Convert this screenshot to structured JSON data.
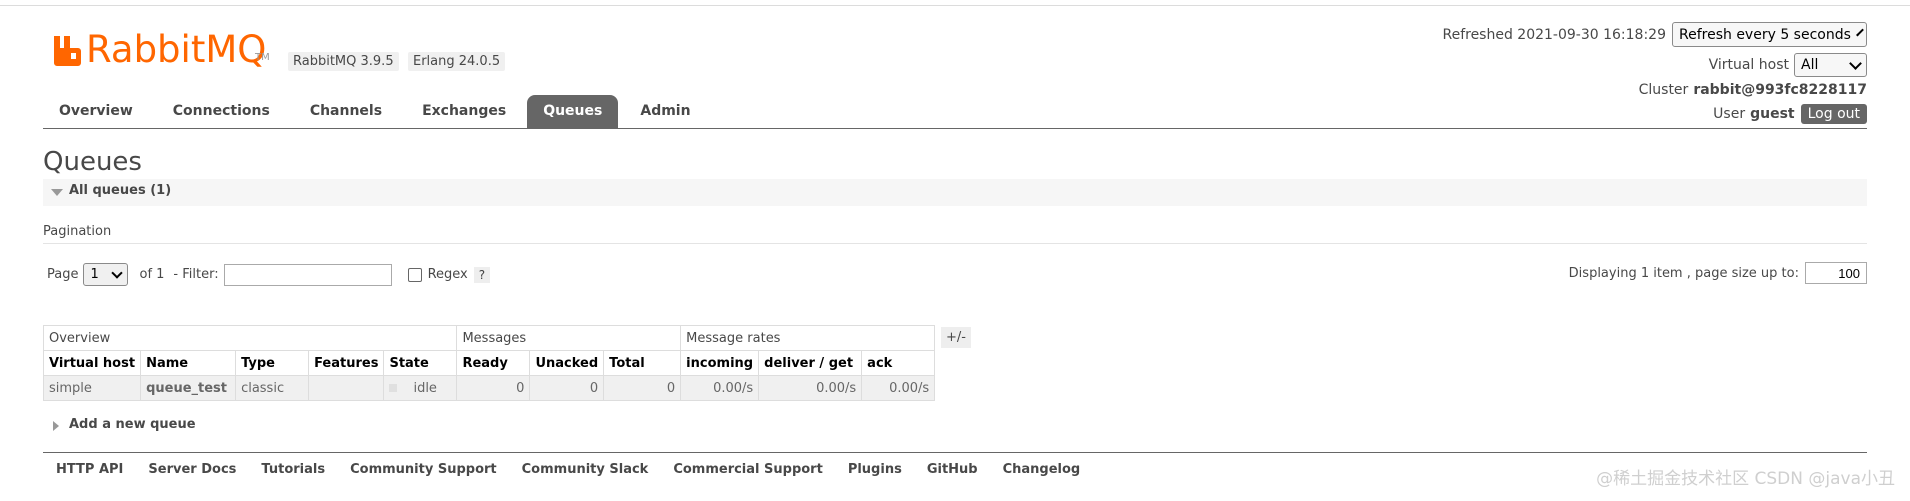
{
  "header": {
    "logo_text": "RabbitMQ",
    "logo_tm": "TM",
    "rabbitmq_version": "RabbitMQ 3.9.5",
    "erlang_version": "Erlang 24.0.5",
    "brand_color": "#ff6600"
  },
  "top_right": {
    "refreshed_label": "Refreshed 2021-09-30 16:18:29",
    "refresh_select": "Refresh every 5 seconds",
    "vhost_label": "Virtual host",
    "vhost_select": "All",
    "cluster_label": "Cluster",
    "cluster_value": "rabbit@993fc8228117",
    "user_label": "User",
    "user_value": "guest",
    "logout_label": "Log out"
  },
  "nav": {
    "tabs": [
      {
        "label": "Overview"
      },
      {
        "label": "Connections"
      },
      {
        "label": "Channels"
      },
      {
        "label": "Exchanges"
      },
      {
        "label": "Queues",
        "active": true
      },
      {
        "label": "Admin"
      }
    ]
  },
  "main": {
    "title": "Queues",
    "section_label": "All queues (1)",
    "pagination_label": "Pagination",
    "page_label": "Page",
    "page_value": "1",
    "of_label": "of 1",
    "filter_label": "- Filter:",
    "filter_value": "",
    "regex_label": "Regex",
    "help_label": "?",
    "displaying_label": "Displaying 1 item , page size up to:",
    "page_size": "100",
    "plus_minus": "+/-",
    "add_queue_label": "Add a new queue"
  },
  "table": {
    "groups": [
      "Overview",
      "Messages",
      "Message rates"
    ],
    "columns": [
      "Virtual host",
      "Name",
      "Type",
      "Features",
      "State",
      "Ready",
      "Unacked",
      "Total",
      "incoming",
      "deliver / get",
      "ack"
    ],
    "rows": [
      {
        "vhost": "simple",
        "name": "queue_test",
        "type": "classic",
        "features": "",
        "state": "idle",
        "ready": "0",
        "unacked": "0",
        "total": "0",
        "incoming": "0.00/s",
        "deliver_get": "0.00/s",
        "ack": "0.00/s"
      }
    ]
  },
  "footer": {
    "links": [
      "HTTP API",
      "Server Docs",
      "Tutorials",
      "Community Support",
      "Community Slack",
      "Commercial Support",
      "Plugins",
      "GitHub",
      "Changelog"
    ]
  },
  "watermark": "@稀土掘金技术社区 CSDN @java小丑"
}
